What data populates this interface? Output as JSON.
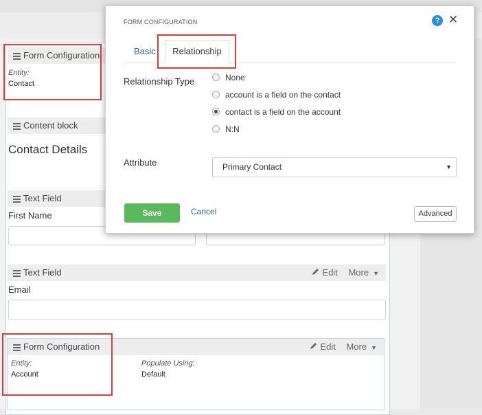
{
  "background": {
    "form_config_1": {
      "title": "Form Configuration",
      "entity_label": "Entity:",
      "entity_value": "Contact"
    },
    "content_block": {
      "title": "Content block",
      "heading": "Contact Details"
    },
    "text_field_1": {
      "title": "Text Field",
      "field_label": "First Name"
    },
    "text_field_2": {
      "title": "Text Field",
      "field_label": "Email",
      "edit_label": "Edit",
      "more_label": "More"
    },
    "form_config_2": {
      "title": "Form Configuration",
      "edit_label": "Edit",
      "more_label": "More",
      "entity_label": "Entity:",
      "entity_value": "Account",
      "populate_label": "Populate Using:",
      "populate_value": "Default"
    }
  },
  "modal": {
    "title": "FORM CONFIGURATION",
    "help_icon": "question-circle-icon",
    "close_icon": "close-icon",
    "tabs": [
      {
        "label": "Basic",
        "active": false
      },
      {
        "label": "Relationship",
        "active": true
      }
    ],
    "relationship_type_label": "Relationship Type",
    "options": [
      {
        "label": "None",
        "checked": false
      },
      {
        "label": "account is a field on the contact",
        "checked": false
      },
      {
        "label": "contact is a field on the account",
        "checked": true
      },
      {
        "label": "N:N",
        "checked": false
      }
    ],
    "attribute_label": "Attribute",
    "attribute_value": "Primary Contact",
    "save_label": "Save",
    "cancel_label": "Cancel",
    "advanced_label": "Advanced"
  },
  "colors": {
    "save": "#5cb85c",
    "link": "#2b6aa6",
    "help": "#2b8fe0",
    "highlight": "#e53935"
  }
}
